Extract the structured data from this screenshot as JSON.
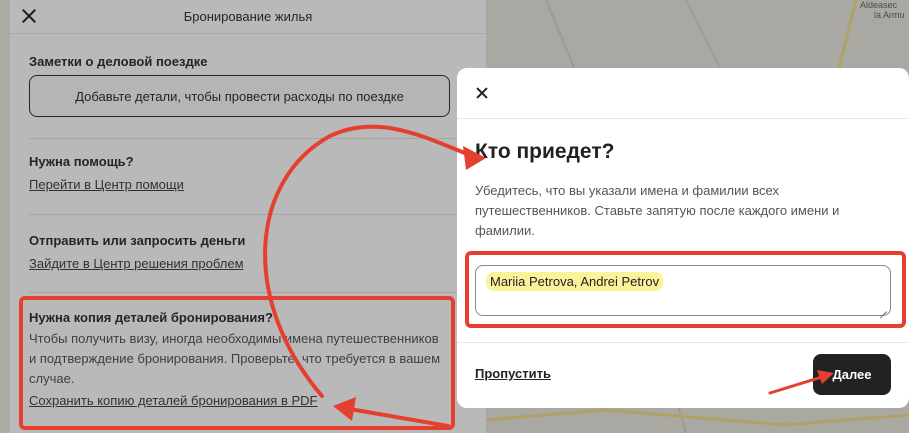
{
  "panel": {
    "title": "Бронирование жилья",
    "business_notes": {
      "heading": "Заметки о деловой поездке",
      "button": "Добавьте детали, чтобы провести расходы по поездке"
    },
    "help": {
      "heading": "Нужна помощь?",
      "link": "Перейти в Центр помощи"
    },
    "money": {
      "heading": "Отправить или запросить деньги",
      "link": "Зайдите в Центр решения проблем"
    },
    "copy": {
      "heading": "Нужна копия деталей бронирования?",
      "text_line1": "Чтобы получить визу, иногда необходимы имена путешественников",
      "text_line2": "и подтверждение бронирования. Проверьте, что требуется в вашем",
      "text_line3": "случае.",
      "link": "Сохранить копию деталей бронирования в PDF"
    }
  },
  "map": {
    "label_line1": "Aldeasec",
    "label_line2": "la Armu"
  },
  "modal": {
    "title": "Кто приедет?",
    "desc_line1": "Убедитесь, что вы указали имена и фамилии всех",
    "desc_line2": "путешественников. Ставьте запятую после каждого имени и",
    "desc_line3": "фамилии.",
    "names_value": "Mariia Petrova, Andrei Petrov",
    "skip_label": "Пропустить",
    "next_label": "Далее"
  },
  "colors": {
    "annotation": "#e5402f",
    "highlight": "#fbf29a",
    "primary_button": "#222222"
  }
}
